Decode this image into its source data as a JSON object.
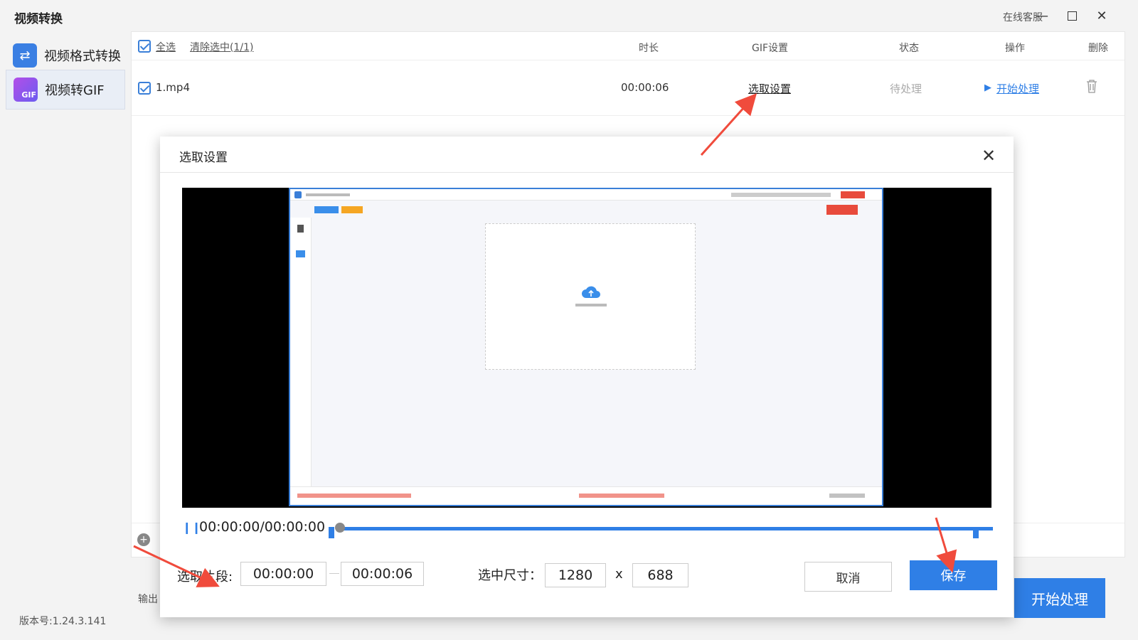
{
  "app": {
    "title": "视频转换",
    "service": "在线客服",
    "version": "版本号:1.24.3.141"
  },
  "sidebar": {
    "items": [
      {
        "label": "视频格式转换",
        "icon": "swap-arrows-icon"
      },
      {
        "label": "视频转GIF",
        "icon": "gif-icon",
        "badge": "GIF"
      }
    ]
  },
  "table": {
    "select_all": "全选",
    "clear_selected": "清除选中(1/1)",
    "columns": {
      "duration": "时长",
      "gif": "GIF设置",
      "status": "状态",
      "action": "操作",
      "delete": "删除"
    },
    "rows": [
      {
        "name": "1.mp4",
        "duration": "00:00:06",
        "gif": "选取设置",
        "status": "待处理",
        "action": "开始处理"
      }
    ]
  },
  "output_label": "输出",
  "start_button": "开始处理",
  "dialog": {
    "title": "选取设置",
    "player": {
      "time": "00:00:00/00:00:00"
    },
    "segment_label": "选取片段:",
    "segment_start": "00:00:00",
    "segment_end": "00:00:06",
    "size_label": "选中尺寸：",
    "width": "1280",
    "x": "x",
    "height": "688",
    "cancel": "取消",
    "save": "保存"
  },
  "colors": {
    "accent": "#2f7fe6",
    "arrow": "#f04b3c"
  }
}
